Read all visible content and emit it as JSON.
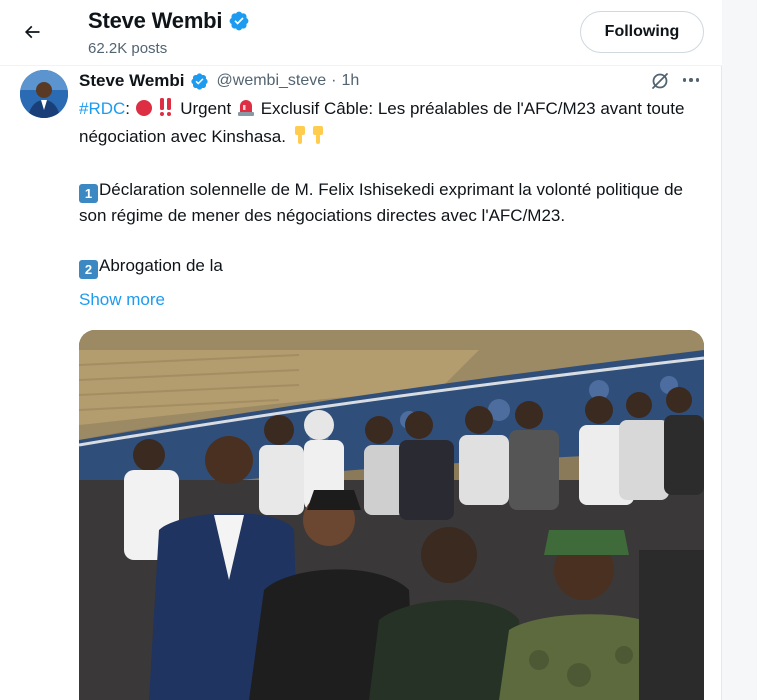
{
  "header": {
    "name": "Steve Wembi",
    "posts": "62.2K posts",
    "follow_label": "Following"
  },
  "tweet": {
    "name": "Steve Wembi",
    "handle": "@wembi_steve",
    "separator": "·",
    "time": "1h",
    "hashtag": "#RDC",
    "line1_a": ": ",
    "line1_b": " Urgent ",
    "line1_c": " Exclusif Câble: Les préalables de l'AFC/M23 avant toute négociation avec Kinshasa. ",
    "item1_num": "1",
    "item1_text": "Déclaration solennelle de M. Felix Ishisekedi exprimant la volonté politique de son régime de mener des négociations directes avec l'AFC/M23.",
    "item2_num": "2",
    "item2_text": "Abrogation de la",
    "show_more": "Show more"
  },
  "icons": {
    "back": "arrow-left-icon",
    "verified": "verified-badge-icon",
    "grok": "grok-icon",
    "more": "more-dots-icon"
  },
  "colors": {
    "accent": "#1d9bf0",
    "text": "#0f1419",
    "secondary": "#536471"
  }
}
